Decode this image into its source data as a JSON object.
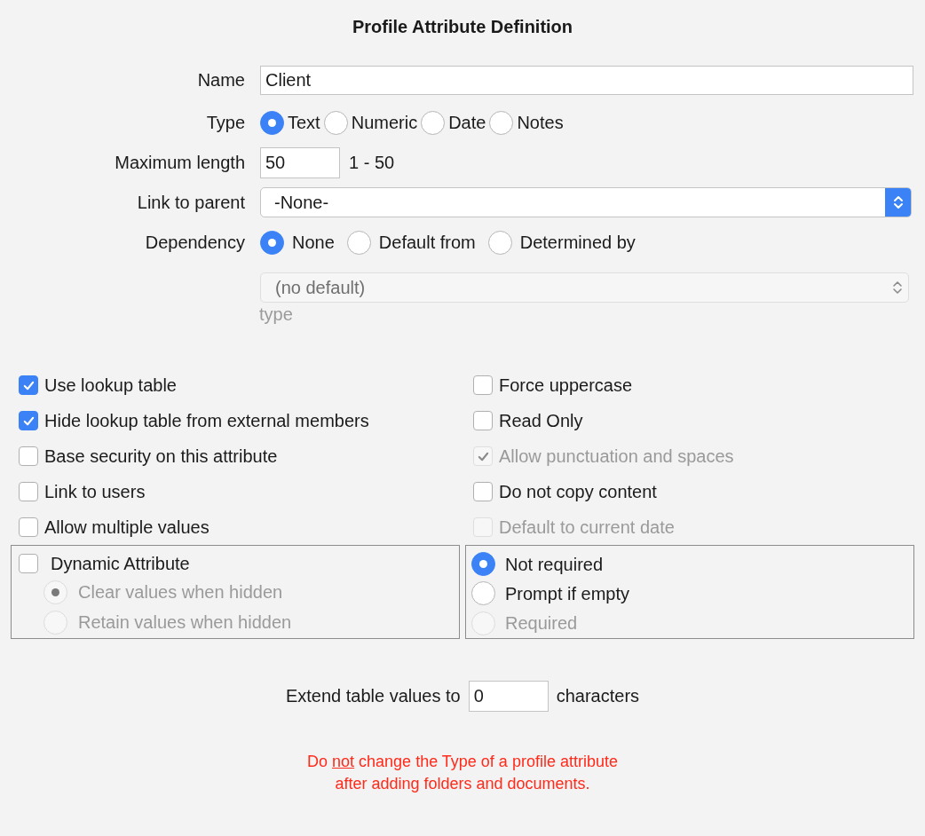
{
  "title": "Profile Attribute Definition",
  "name": {
    "label": "Name",
    "value": "Client"
  },
  "type": {
    "label": "Type",
    "options": [
      {
        "label": "Text",
        "selected": true
      },
      {
        "label": "Numeric",
        "selected": false
      },
      {
        "label": "Date",
        "selected": false
      },
      {
        "label": "Notes",
        "selected": false
      }
    ]
  },
  "max_length": {
    "label": "Maximum length",
    "value": "50",
    "range": "1 - 50"
  },
  "link_to_parent": {
    "label": "Link to parent",
    "value": "-None-"
  },
  "dependency": {
    "label": "Dependency",
    "options": [
      {
        "label": "None",
        "selected": true
      },
      {
        "label": "Default from",
        "selected": false
      },
      {
        "label": "Determined by",
        "selected": false
      }
    ],
    "select": {
      "value": "(no default)",
      "disabled": true
    },
    "hint": "type"
  },
  "checkboxes_left": [
    {
      "label": "Use lookup table",
      "checked": true,
      "disabled": false
    },
    {
      "label": "Hide lookup table from external members",
      "checked": true,
      "disabled": false
    },
    {
      "label": "Base security on this attribute",
      "checked": false,
      "disabled": false
    },
    {
      "label": "Link to users",
      "checked": false,
      "disabled": false
    },
    {
      "label": "Allow multiple values",
      "checked": false,
      "disabled": false
    }
  ],
  "checkboxes_right": [
    {
      "label": "Force uppercase",
      "checked": false,
      "disabled": false
    },
    {
      "label": "Read Only",
      "checked": false,
      "disabled": false
    },
    {
      "label": "Allow punctuation and spaces",
      "checked": true,
      "disabled": true
    },
    {
      "label": "Do not copy content",
      "checked": false,
      "disabled": false
    },
    {
      "label": "Default to current date",
      "checked": false,
      "disabled": true
    }
  ],
  "dynamic": {
    "label": "Dynamic Attribute",
    "checked": false,
    "options": [
      {
        "label": "Clear values when hidden",
        "selected": true,
        "disabled": true
      },
      {
        "label": "Retain values when hidden",
        "selected": false,
        "disabled": true
      }
    ]
  },
  "requirement": {
    "options": [
      {
        "label": "Not required",
        "selected": true,
        "disabled": false
      },
      {
        "label": "Prompt if empty",
        "selected": false,
        "disabled": false
      },
      {
        "label": "Required",
        "selected": false,
        "disabled": true
      }
    ]
  },
  "extend": {
    "before": "Extend table values to",
    "value": "0",
    "after": "characters"
  },
  "warning": {
    "lead": "Do ",
    "underlined": "not",
    "rest": " change the Type of a profile attribute",
    "line2": "after adding folders and documents."
  }
}
